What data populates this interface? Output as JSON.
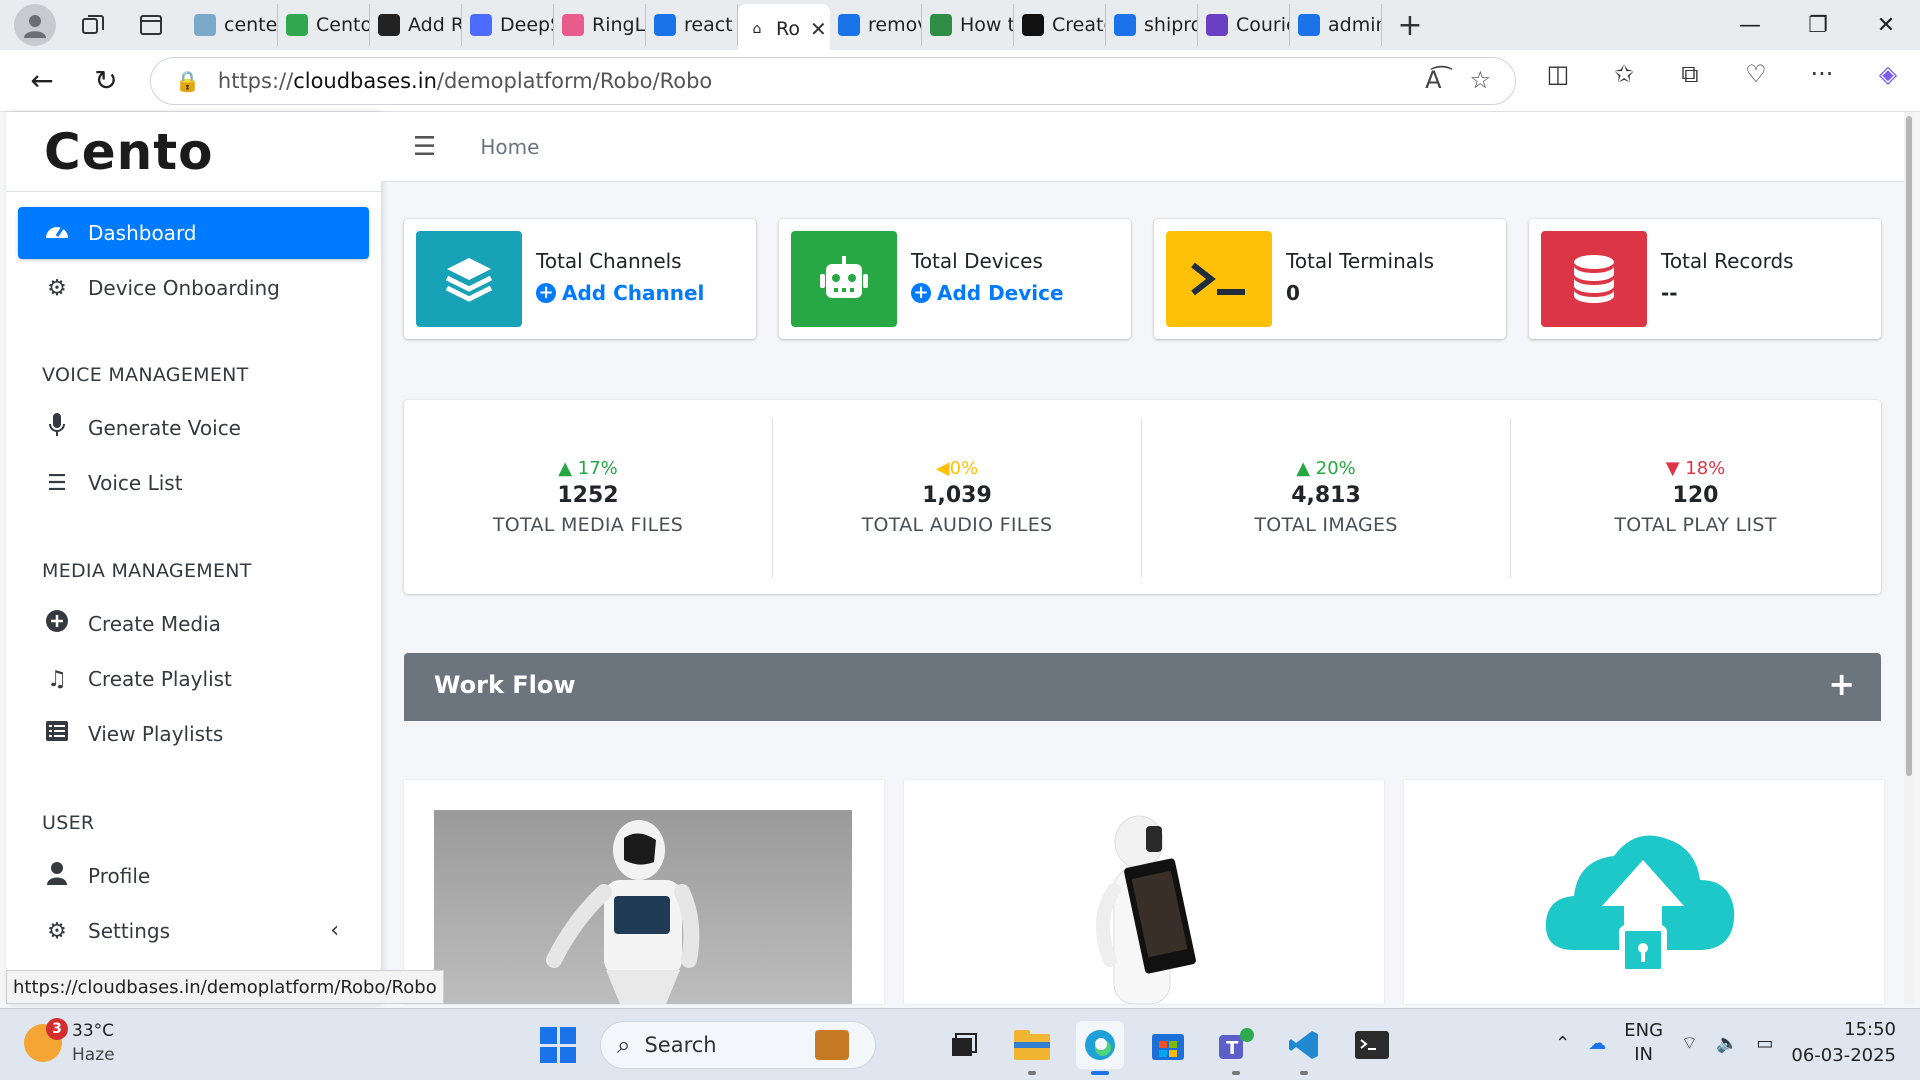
{
  "browser": {
    "tabs": [
      {
        "label": "centelo",
        "color": "#7aa9c9"
      },
      {
        "label": "Centor",
        "color": "#2fa84f"
      },
      {
        "label": "Add Ro",
        "color": "#222222"
      },
      {
        "label": "DeepSe",
        "color": "#4d6bfe"
      },
      {
        "label": "RingLo",
        "color": "#e85b8a"
      },
      {
        "label": "react h",
        "color": "#1a73e8"
      },
      {
        "label": "Ro",
        "color": "#222222",
        "active": true
      },
      {
        "label": "remove",
        "color": "#1a73e8"
      },
      {
        "label": "How to",
        "color": "#2f8d46"
      },
      {
        "label": "Create",
        "color": "#111111"
      },
      {
        "label": "shiproc",
        "color": "#1a73e8"
      },
      {
        "label": "Courie",
        "color": "#6a3fc4"
      },
      {
        "label": "admin",
        "color": "#1a73e8"
      }
    ],
    "url_scheme": "https://",
    "url_host": "cloudbases.in",
    "url_path": "/demoplatform/Robo/Robo",
    "status_url": "https://cloudbases.in/demoplatform/Robo/Robo"
  },
  "sidebar": {
    "brand": "Cento",
    "items": [
      {
        "label": "Dashboard",
        "active": true
      },
      {
        "label": "Device Onboarding"
      }
    ],
    "sections": [
      {
        "header": "VOICE MANAGEMENT",
        "items": [
          {
            "label": "Generate Voice"
          },
          {
            "label": "Voice List"
          }
        ]
      },
      {
        "header": "MEDIA MANAGEMENT",
        "items": [
          {
            "label": "Create Media"
          },
          {
            "label": "Create Playlist"
          },
          {
            "label": "View Playlists"
          }
        ]
      },
      {
        "header": "USER",
        "items": [
          {
            "label": "Profile"
          },
          {
            "label": "Settings"
          }
        ]
      }
    ]
  },
  "topnav": {
    "breadcrumb": "Home"
  },
  "info_boxes": [
    {
      "title": "Total Channels",
      "link": "Add Channel",
      "color": "#17a2b8"
    },
    {
      "title": "Total Devices",
      "link": "Add Device",
      "color": "#28a745"
    },
    {
      "title": "Total Terminals",
      "value": "0",
      "color": "#ffc107"
    },
    {
      "title": "Total Records",
      "value": "--",
      "color": "#dc3545"
    }
  ],
  "stats": [
    {
      "pct": "17%",
      "trend": "up",
      "value": "1252",
      "label": "TOTAL MEDIA FILES",
      "color": "#28a745"
    },
    {
      "pct": "0%",
      "trend": "left",
      "value": "1,039",
      "label": "TOTAL AUDIO FILES",
      "color": "#ffc107"
    },
    {
      "pct": "20%",
      "trend": "up",
      "value": "4,813",
      "label": "TOTAL IMAGES",
      "color": "#28a745"
    },
    {
      "pct": "18%",
      "trend": "down",
      "value": "120",
      "label": "TOTAL PLAY LIST",
      "color": "#dc3545"
    }
  ],
  "workflow": {
    "title": "Work Flow",
    "toggle": "+"
  },
  "taskbar": {
    "weather_temp": "33°C",
    "weather_desc": "Haze",
    "weather_badge": "3",
    "search_placeholder": "Search",
    "lang_top": "ENG",
    "lang_bottom": "IN",
    "time": "15:50",
    "date": "06-03-2025"
  }
}
